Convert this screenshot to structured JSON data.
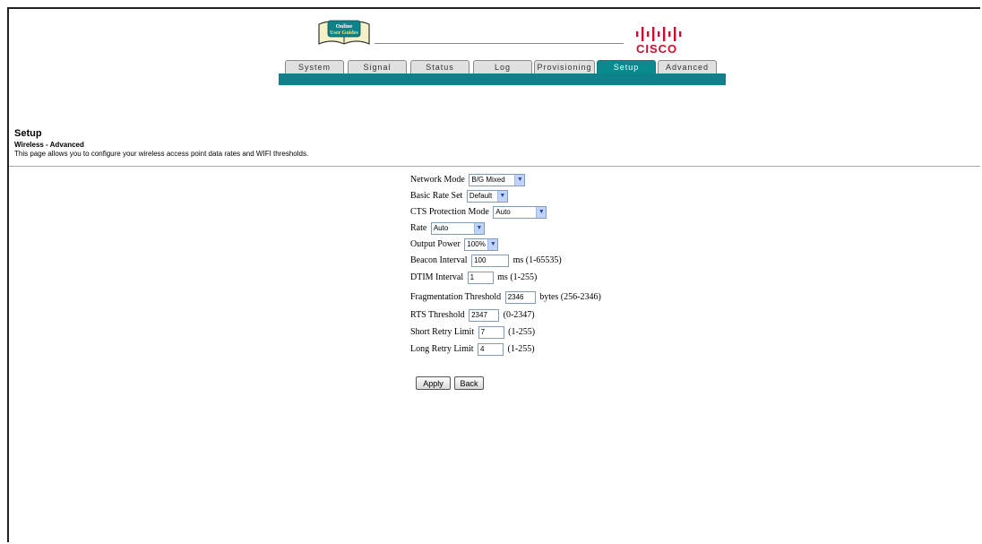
{
  "header": {
    "logo_text": [
      "Online",
      "User Guides"
    ],
    "brand": "CISCO"
  },
  "tabs": [
    {
      "label": "System",
      "active": false
    },
    {
      "label": "Signal",
      "active": false
    },
    {
      "label": "Status",
      "active": false
    },
    {
      "label": "Log",
      "active": false
    },
    {
      "label": "Provisioning",
      "active": false
    },
    {
      "label": "Setup",
      "active": true
    },
    {
      "label": "Advanced",
      "active": false
    }
  ],
  "page": {
    "title": "Setup",
    "subtitle": "Wireless - Advanced",
    "description": "This page allows you to configure your wireless access point data rates and WIFI thresholds."
  },
  "form": {
    "network_mode": {
      "label": "Network Mode",
      "value": "B/G Mixed"
    },
    "basic_rate_set": {
      "label": "Basic Rate Set",
      "value": "Default"
    },
    "cts_protection_mode": {
      "label": "CTS Protection Mode",
      "value": "Auto"
    },
    "rate": {
      "label": "Rate",
      "value": "Auto"
    },
    "output_power": {
      "label": "Output Power",
      "value": "100%"
    },
    "beacon_interval": {
      "label": "Beacon Interval",
      "value": "100",
      "unit": "ms (1-65535)"
    },
    "dtim_interval": {
      "label": "DTIM Interval",
      "value": "1",
      "unit": "ms (1-255)"
    },
    "fragmentation_threshold": {
      "label": "Fragmentation Threshold",
      "value": "2346",
      "unit": "bytes (256-2346)"
    },
    "rts_threshold": {
      "label": "RTS Threshold",
      "value": "2347",
      "unit": "(0-2347)"
    },
    "short_retry_limit": {
      "label": "Short Retry Limit",
      "value": "7",
      "unit": "(1-255)"
    },
    "long_retry_limit": {
      "label": "Long Retry Limit",
      "value": "4",
      "unit": "(1-255)"
    }
  },
  "buttons": {
    "apply": "Apply",
    "back": "Back"
  },
  "colors": {
    "tab_active": "#0a8a8e",
    "teal_bar": "#0d8389",
    "brand_red": "#c8102e"
  }
}
